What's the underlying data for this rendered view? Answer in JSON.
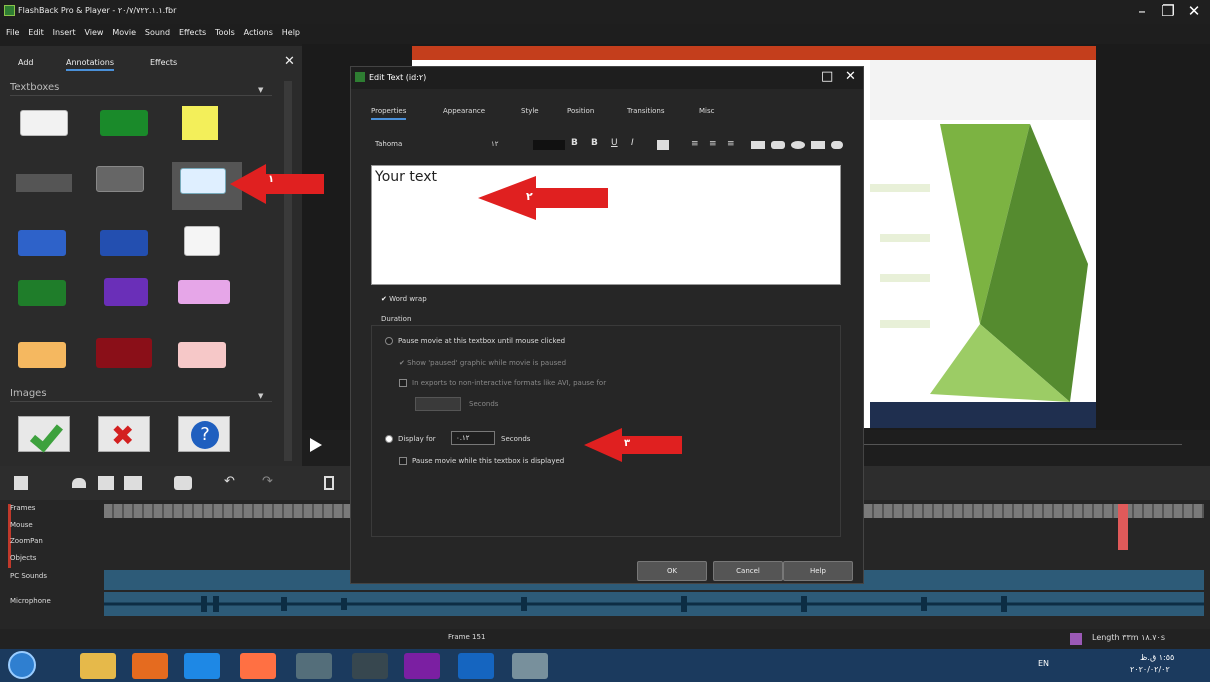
{
  "window": {
    "title": "FlashBack Pro & Player - ٢٠/٧/٧٢٢.١.١.fbr",
    "controls": [
      "–",
      "❐",
      "✕"
    ]
  },
  "menu": [
    "File",
    "Edit",
    "Insert",
    "View",
    "Movie",
    "Sound",
    "Effects",
    "Tools",
    "Actions",
    "Help"
  ],
  "left_panel": {
    "tabs": [
      "Add",
      "Annotations",
      "Effects"
    ],
    "close": "✕",
    "textboxes_label": "Textboxes",
    "images_label": "Images"
  },
  "dialog": {
    "title": "Edit Text (id:٢)",
    "tabs": [
      "Properties",
      "Appearance",
      "Style",
      "Position",
      "Transitions",
      "Misc"
    ],
    "font": "Tahoma",
    "font_size": "١٢",
    "edit_text": "Your text",
    "word_wrap": "Word wrap",
    "duration_label": "Duration",
    "pause_until_click": "Pause movie at this textbox until mouse clicked",
    "show_paused": "Show 'paused' graphic while movie is paused",
    "in_exports": "In exports to non-interactive formats like AVI, pause for",
    "seconds_small": "Seconds",
    "display_for": "Display for",
    "display_value": "٠.١٢",
    "seconds": "Seconds",
    "pause_while_displayed": "Pause movie while this textbox is displayed",
    "buttons": {
      "ok": "OK",
      "cancel": "Cancel",
      "help": "Help"
    }
  },
  "arrows": {
    "a1": "١",
    "a2": "٢",
    "a3": "٣"
  },
  "tracks": {
    "names": [
      "Frames",
      "Mouse",
      "ZoomPan",
      "Objects"
    ],
    "pc_sounds": "PC Sounds",
    "microphone": "Microphone"
  },
  "status": {
    "frame": "Frame 151",
    "length": "Length ٣٣m ١٨.٧٠s"
  },
  "taskbar": {
    "lang": "EN",
    "time": "١:٥٥ ق.ظ",
    "date": "٢٠٢٠/٠٢/٠٢"
  },
  "colors": {
    "arrow": "#e02020",
    "accent": "#4a90d9",
    "ppt": "#c43e1c"
  }
}
